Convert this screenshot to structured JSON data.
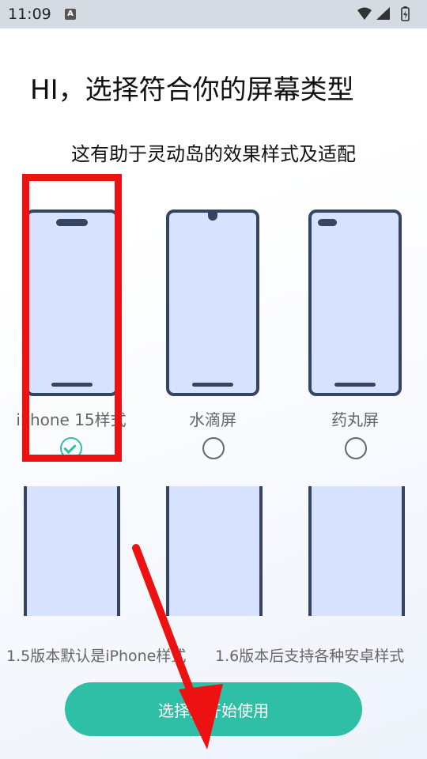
{
  "status": {
    "time": "11:09",
    "badge": "A"
  },
  "title": "HI，选择符合你的屏幕类型",
  "subtitle": "这有助于灵动岛的效果样式及适配",
  "options": [
    {
      "label": "iPhone 15样式",
      "selected": true
    },
    {
      "label": "水滴屏",
      "selected": false
    },
    {
      "label": "药丸屏",
      "selected": false
    }
  ],
  "notes": {
    "left": "1.5版本默认是iPhone样式",
    "right": "1.6版本后支持各种安卓样式"
  },
  "button": {
    "label": "选择并开始使用"
  },
  "colors": {
    "accent": "#2fbfa6",
    "phone_frame": "#354463",
    "phone_fill": "#d6e2ff",
    "annotation": "#ee1111"
  }
}
